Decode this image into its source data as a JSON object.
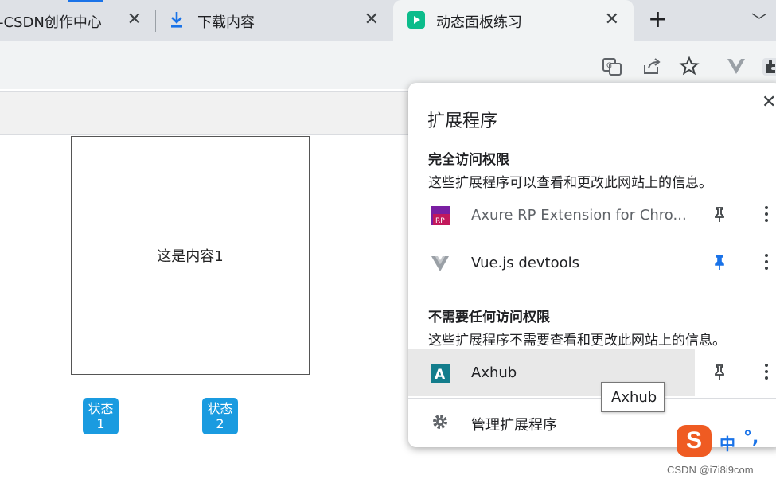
{
  "tabs": [
    {
      "title": "-CSDN创作中心"
    },
    {
      "title": "下载内容"
    },
    {
      "title": "动态面板练习"
    }
  ],
  "tab_close_glyph": "✕",
  "new_tab_glyph": "+",
  "tab_menu_glyph": "﹀",
  "page": {
    "content_text": "这是内容1",
    "state_buttons": [
      {
        "line1": "状态",
        "line2": "1"
      },
      {
        "line1": "状态",
        "line2": "2"
      }
    ],
    "state_button_color": "#1a9be0"
  },
  "extensions_popup": {
    "title": "扩展程序",
    "close_glyph": "✕",
    "full_access_heading": "完全访问权限",
    "full_access_desc": "这些扩展程序可以查看和更改此网站上的信息。",
    "full_access_items": [
      {
        "name": "Axure RP Extension for Chro...",
        "icon": "axure-rp-icon",
        "pinned": false
      },
      {
        "name": "Vue.js devtools",
        "icon": "vue-devtools-icon",
        "pinned": true
      }
    ],
    "no_access_heading": "不需要任何访问权限",
    "no_access_desc": "这些扩展程序不需要查看和更改此网站上的信息。",
    "no_access_items": [
      {
        "name": "Axhub",
        "icon": "axhub-icon",
        "pinned": false
      }
    ],
    "manage_label": "管理扩展程序",
    "pin_color_active": "#1a73e8",
    "pin_color_inactive": "#3c4043"
  },
  "tooltip": "Axhub",
  "ime": {
    "logo": "S",
    "mode": "中",
    "punct": "°,"
  },
  "watermark": "CSDN @i7i8i9com"
}
